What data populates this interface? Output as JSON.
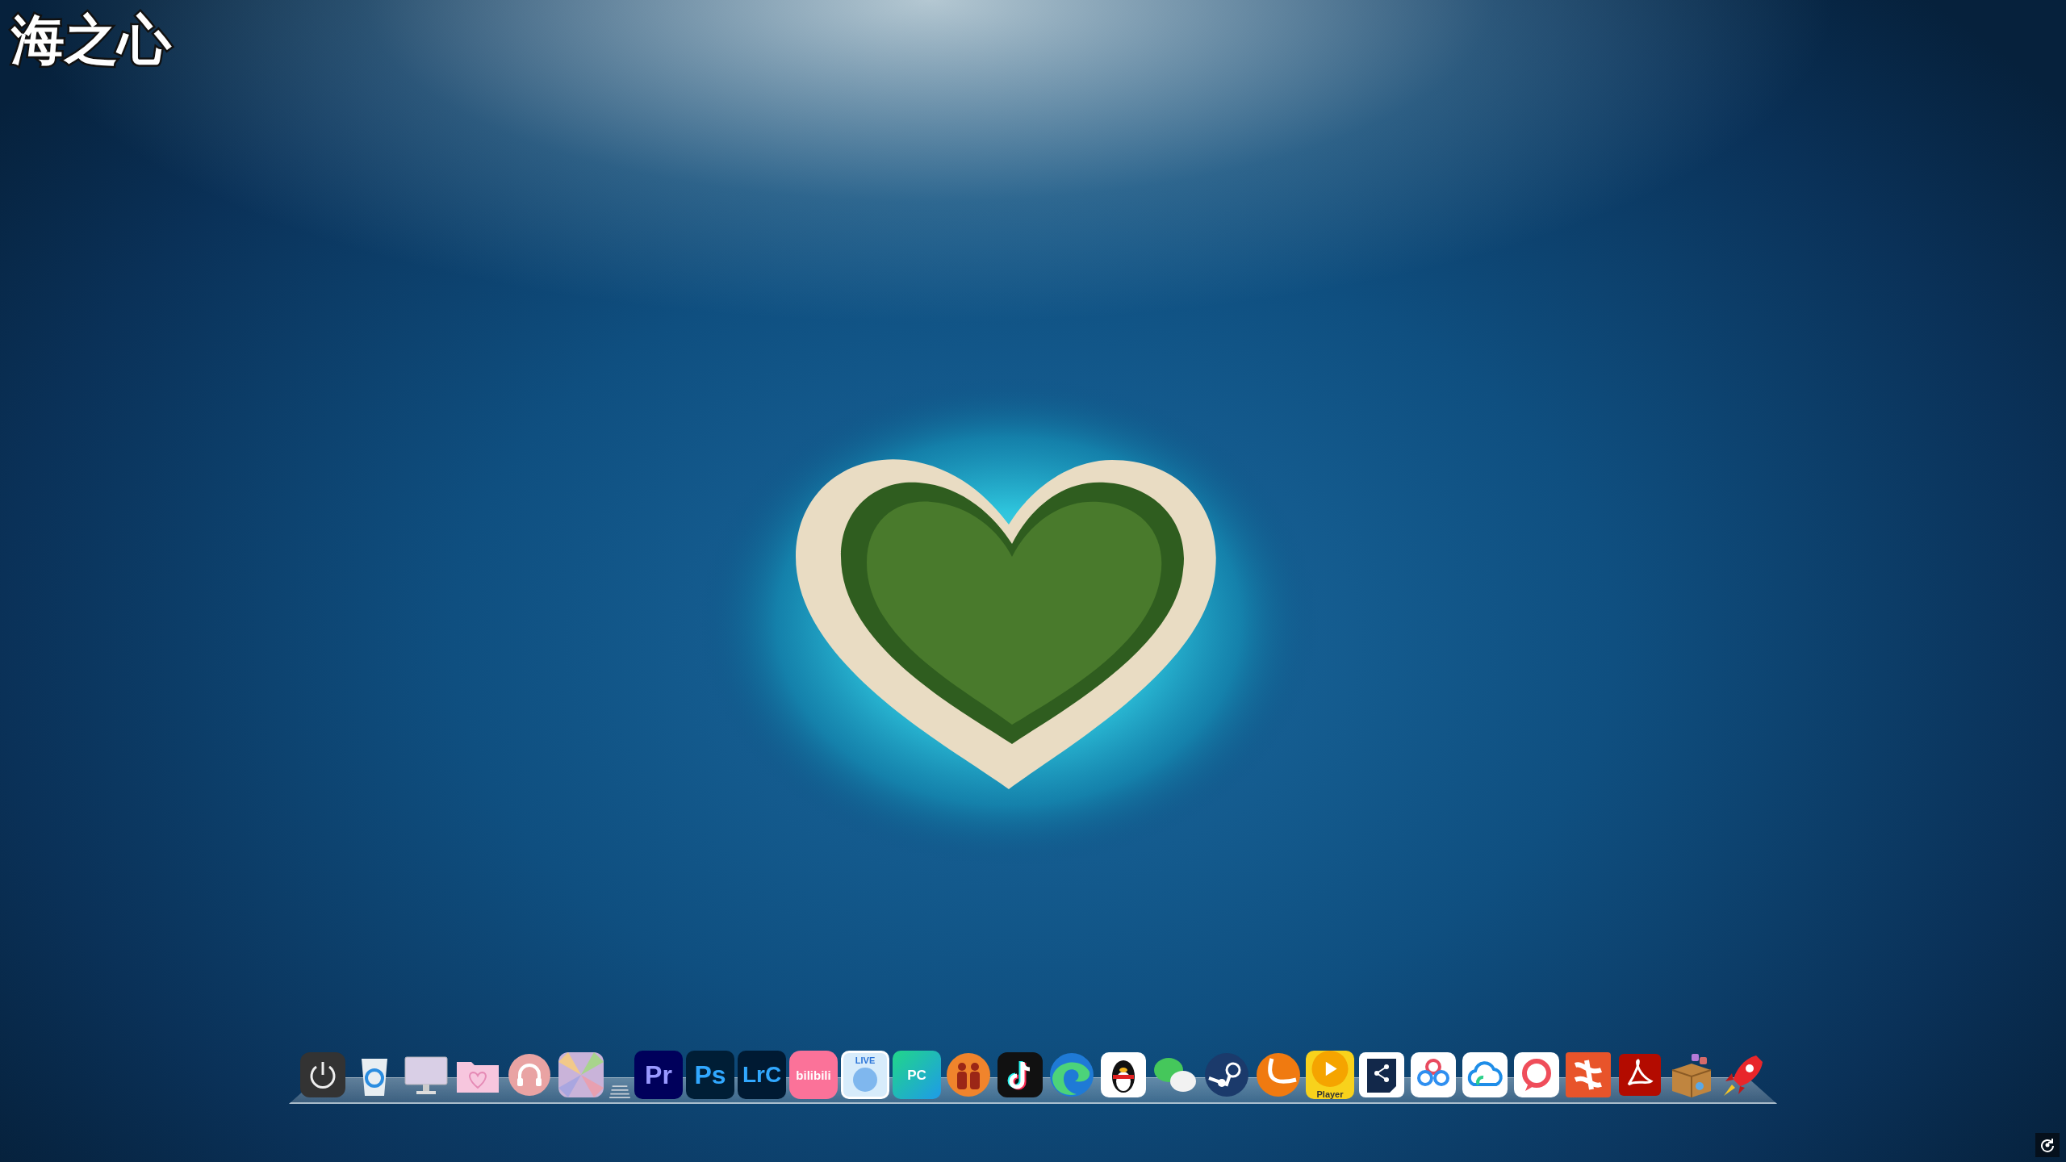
{
  "desktop": {
    "title": "海之心"
  },
  "dock": {
    "items": [
      {
        "kind": "power"
      },
      {
        "kind": "recycle"
      },
      {
        "kind": "monitor"
      },
      {
        "kind": "folder"
      },
      {
        "kind": "headphones"
      },
      {
        "kind": "photos"
      },
      {
        "kind": "stack"
      },
      {
        "kind": "pr",
        "label": "Pr"
      },
      {
        "kind": "ps",
        "label": "Ps"
      },
      {
        "kind": "lrc",
        "label": "LrC"
      },
      {
        "kind": "bilibili",
        "label": "bilibili"
      },
      {
        "kind": "live",
        "label": "LIVE"
      },
      {
        "kind": "pc",
        "label": "PC"
      },
      {
        "kind": "people"
      },
      {
        "kind": "tiktok"
      },
      {
        "kind": "edge"
      },
      {
        "kind": "penguin"
      },
      {
        "kind": "chat"
      },
      {
        "kind": "steam"
      },
      {
        "kind": "ball"
      },
      {
        "kind": "player",
        "label": "Player"
      },
      {
        "kind": "share"
      },
      {
        "kind": "rings"
      },
      {
        "kind": "cloud"
      },
      {
        "kind": "bubble"
      },
      {
        "kind": "ribbon"
      },
      {
        "kind": "acrobat"
      },
      {
        "kind": "box"
      },
      {
        "kind": "rocket"
      }
    ]
  },
  "corner_button": {
    "kind": "rotate"
  }
}
